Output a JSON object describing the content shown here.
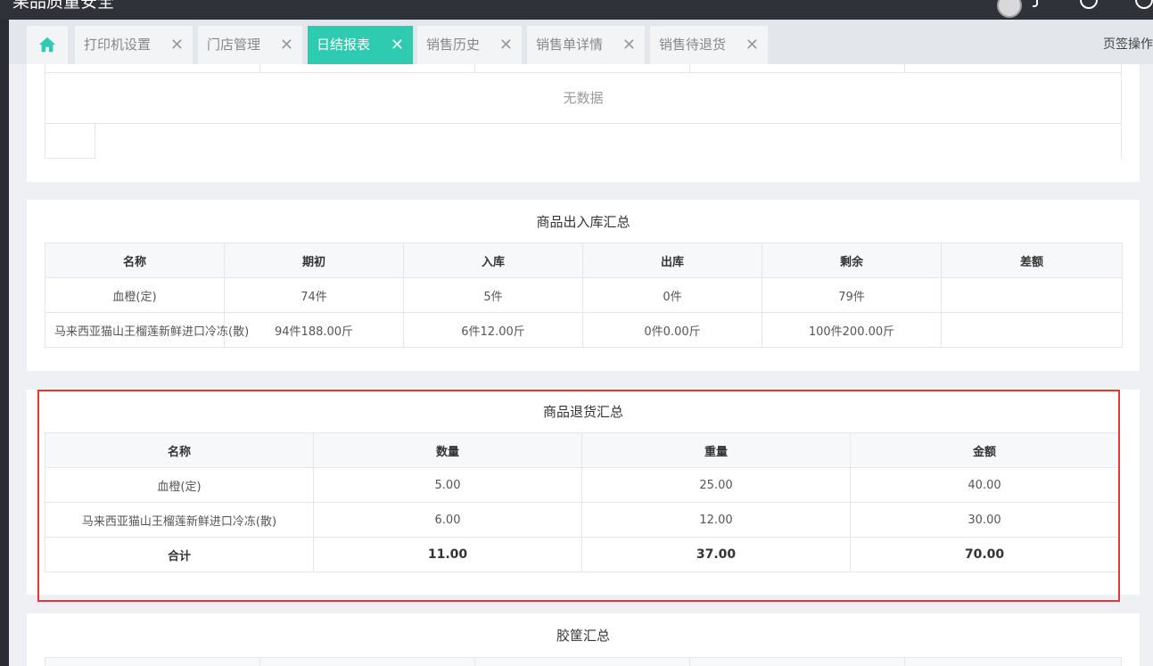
{
  "app": {
    "title": "果品质量安全"
  },
  "tabs": [
    {
      "label": "打印机设置"
    },
    {
      "label": "门店管理"
    },
    {
      "label": "日结报表"
    },
    {
      "label": "销售历史"
    },
    {
      "label": "销售单详情"
    },
    {
      "label": "销售待退货"
    }
  ],
  "tab_close_glyph": "✕",
  "page_ops": "页签操作",
  "empty_table": {
    "message": "无数据"
  },
  "stock_summary": {
    "title": "商品出入库汇总",
    "headers": [
      "名称",
      "期初",
      "入库",
      "出库",
      "剩余",
      "差额"
    ],
    "rows": [
      [
        "血橙(定)",
        "74件",
        "5件",
        "0件",
        "79件",
        ""
      ],
      [
        "马来西亚猫山王榴莲新鲜进口冷冻(散)",
        "94件188.00斤",
        "6件12.00斤",
        "0件0.00斤",
        "100件200.00斤",
        ""
      ]
    ]
  },
  "return_summary": {
    "title": "商品退货汇总",
    "headers": [
      "名称",
      "数量",
      "重量",
      "金额"
    ],
    "rows": [
      [
        "血橙(定)",
        "5.00",
        "25.00",
        "40.00"
      ],
      [
        "马来西亚猫山王榴莲新鲜进口冷冻(散)",
        "6.00",
        "12.00",
        "30.00"
      ]
    ],
    "total": [
      "合计",
      "11.00",
      "37.00",
      "70.00"
    ]
  },
  "crate_summary": {
    "title": "胶筐汇总"
  },
  "colors": {
    "accent": "#2ecbb0",
    "highlight": "#e53935"
  }
}
